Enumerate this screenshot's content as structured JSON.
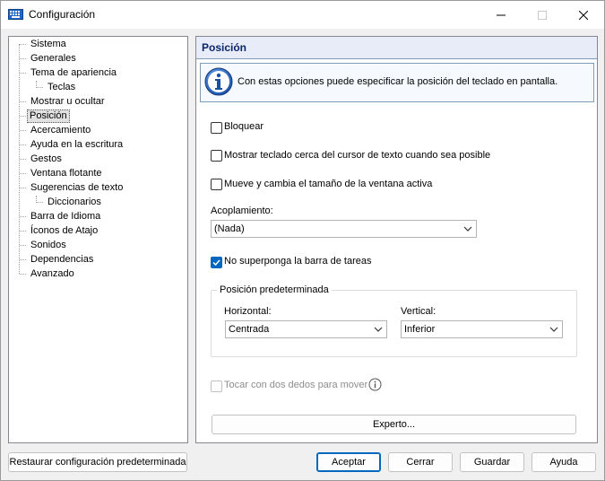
{
  "window": {
    "title": "Configuración"
  },
  "tree": {
    "items": [
      {
        "label": "Sistema"
      },
      {
        "label": "Generales"
      },
      {
        "label": "Tema de apariencia"
      },
      {
        "label": "Teclas"
      },
      {
        "label": "Mostrar u ocultar"
      },
      {
        "label": "Posición",
        "selected": true
      },
      {
        "label": "Acercamiento"
      },
      {
        "label": "Ayuda en la escritura"
      },
      {
        "label": "Gestos"
      },
      {
        "label": "Ventana flotante"
      },
      {
        "label": "Sugerencias de texto"
      },
      {
        "label": "Diccionarios"
      },
      {
        "label": "Barra de Idioma"
      },
      {
        "label": "Íconos de Atajo"
      },
      {
        "label": "Sonidos"
      },
      {
        "label": "Dependencias"
      },
      {
        "label": "Avanzado"
      }
    ]
  },
  "panel": {
    "header": "Posición",
    "info_text": "Con estas opciones puede especificar la posición del teclado en pantalla.",
    "options": {
      "lock": {
        "label": "Bloquear",
        "checked": false
      },
      "near_cursor": {
        "label": "Mostrar teclado cerca del cursor de texto cuando sea posible",
        "checked": false
      },
      "move_resize": {
        "label": "Mueve y cambia el tamaño de la ventana activa",
        "checked": false
      },
      "no_overlap": {
        "label": "No superponga la barra de tareas",
        "checked": true
      },
      "two_finger": {
        "label": "Tocar con dos dedos para mover",
        "checked": false,
        "disabled": true
      }
    },
    "docking": {
      "label": "Acoplamiento:",
      "value": "(Nada)"
    },
    "default_position": {
      "title": "Posición predeterminada",
      "horizontal_label": "Horizontal:",
      "horizontal_value": "Centrada",
      "vertical_label": "Vertical:",
      "vertical_value": "Inferior"
    },
    "expert_button": "Experto..."
  },
  "footer": {
    "restore": "Restaurar configuración predeterminada",
    "accept": "Aceptar",
    "cancel": "Cerrar",
    "save": "Guardar",
    "help": "Ayuda"
  },
  "colors": {
    "accent": "#0067c0",
    "header_text": "#0a246a"
  },
  "icons": [
    "keyboard-icon",
    "minimize-icon",
    "maximize-icon",
    "close-icon",
    "info-icon",
    "chevron-down-icon"
  ]
}
